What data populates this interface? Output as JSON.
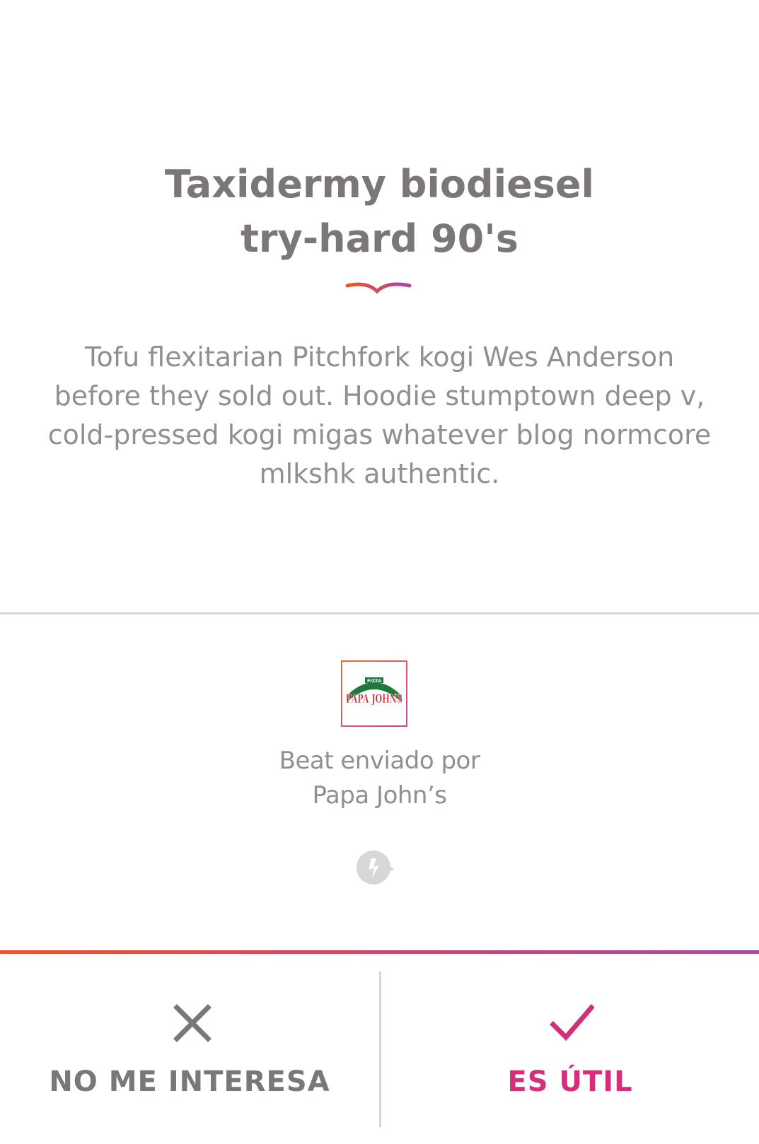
{
  "beat": {
    "title": "Taxidermy biodiesel\ntry-hard 90's",
    "body": "Tofu flexitarian Pitchfork kogi Wes Anderson before they sold out. Hoodie stumptown deep v, cold-pressed kogi migas whatever blog normcore mlkshk authentic."
  },
  "sender": {
    "logo_icon": "papa-johns-logo",
    "logo_text": "PAPA JOHNS",
    "logo_sub": "PIZZA",
    "line1": "Beat enviado por",
    "line2": "Papa John’s"
  },
  "actions": {
    "dismiss_label": "NO ME INTERESA",
    "dismiss_icon": "close-icon",
    "accept_label": "ES ÚTIL",
    "accept_icon": "check-icon"
  },
  "colors": {
    "title": "#7b7677",
    "body": "#938e8f",
    "accent_orange": "#f0502b",
    "accent_purple": "#a449a1",
    "accept": "#d42f7b"
  }
}
